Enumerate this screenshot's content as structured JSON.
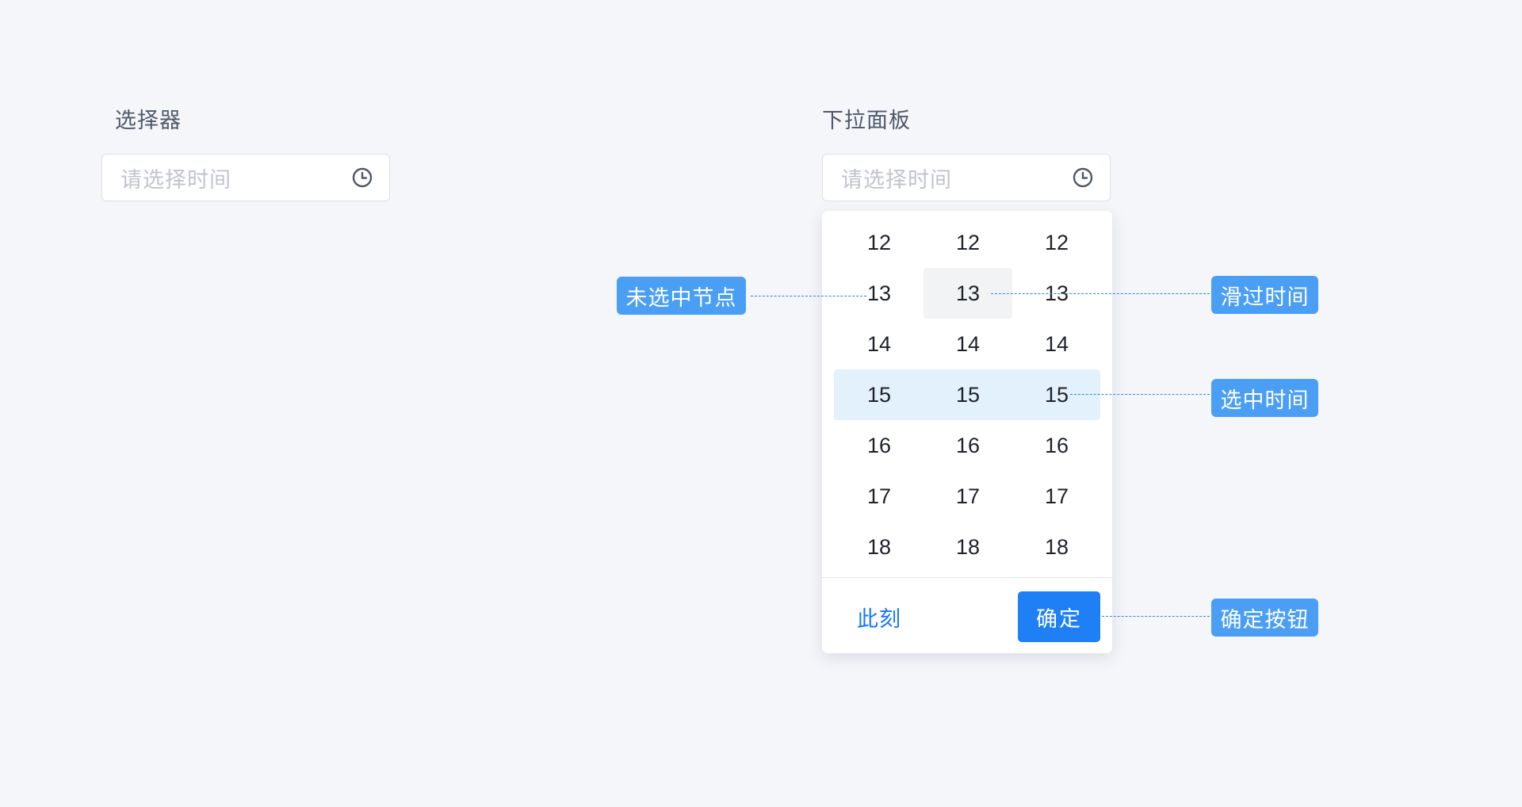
{
  "selector_section": {
    "title": "选择器",
    "placeholder": "请选择时间"
  },
  "dropdown_section": {
    "title": "下拉面板",
    "placeholder": "请选择时间",
    "columns": [
      [
        "12",
        "13",
        "14",
        "15",
        "16",
        "17",
        "18"
      ],
      [
        "12",
        "13",
        "14",
        "15",
        "16",
        "17",
        "18"
      ],
      [
        "12",
        "13",
        "14",
        "15",
        "16",
        "17",
        "18"
      ]
    ],
    "hovered": {
      "column": 2,
      "value": "13"
    },
    "selected": {
      "values": [
        "15",
        "15",
        "15"
      ]
    },
    "now_label": "此刻",
    "confirm_label": "确定"
  },
  "annotations": {
    "unselected": "未选中节点",
    "hover": "滑过时间",
    "selected": "选中时间",
    "confirm": "确定按钮"
  },
  "icons": {
    "picker_icon": "clock-icon"
  },
  "colors": {
    "primary": "#1f7ff5",
    "link": "#1677ff",
    "annotation_tag": "#4a9ff5",
    "selected_row_bg": "#e3f1fc",
    "hover_bg": "#f2f3f5",
    "placeholder": "#c0c4cc"
  }
}
